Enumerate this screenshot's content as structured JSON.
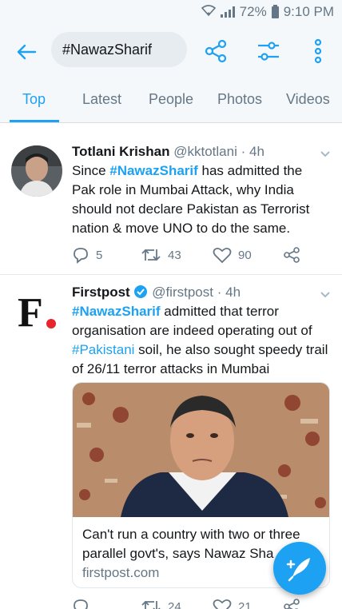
{
  "status_bar": {
    "battery": "72%",
    "time": "9:10 PM",
    "network": "4G"
  },
  "search": {
    "query": "#NawazSharif"
  },
  "tabs": [
    {
      "label": "Top",
      "active": true
    },
    {
      "label": "Latest",
      "active": false
    },
    {
      "label": "People",
      "active": false
    },
    {
      "label": "Photos",
      "active": false
    },
    {
      "label": "Videos",
      "active": false
    }
  ],
  "tweets": [
    {
      "name": "Totlani Krishan",
      "handle": "@kktotlani",
      "time": "4h",
      "text": {
        "p1": "Since ",
        "h1": "#NawazSharif",
        "p2": " has admitted the Pak role in Mumbai Attack, why India should not declare Pakistan as Terrorist nation & move UNO to do the same."
      },
      "replies": "5",
      "retweets": "43",
      "likes": "90"
    },
    {
      "name": "Firstpost",
      "verified": true,
      "handle": "@firstpost",
      "time": "4h",
      "avatar_letter": "F",
      "text": {
        "h1": "#NawazSharif",
        "p1": " admitted that terror organisation are indeed operating out of ",
        "h2": "#Pakistani",
        "p2": " soil, he also sought speedy trail of 26/11 terror attacks in Mumbai"
      },
      "card": {
        "title_line1": "Can't run a country with two or three",
        "title_line2": "parallel govt's, says Nawaz Sha",
        "domain": "firstpost.com"
      },
      "retweets": "24",
      "likes": "21"
    }
  ],
  "colors": {
    "accent": "#1da1f2",
    "secondary_text": "#657786",
    "firstpost_dot": "#e8242c"
  }
}
